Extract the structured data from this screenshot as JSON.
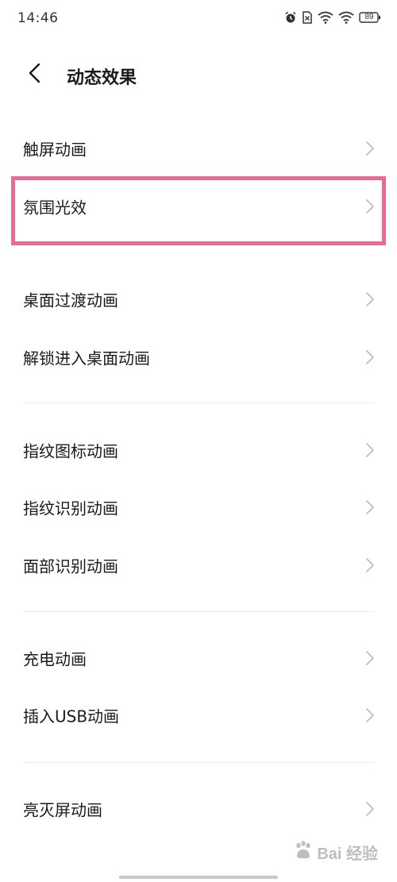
{
  "status_bar": {
    "time": "14:46",
    "battery": "89",
    "icons": [
      "alarm-icon",
      "sim-off-icon",
      "wifi-icon",
      "wifi-icon",
      "battery-icon"
    ]
  },
  "header": {
    "back_icon": "chevron-left-icon",
    "title": "动态效果"
  },
  "groups": [
    {
      "items": [
        {
          "label": "触屏动画"
        },
        {
          "label": "氛围光效"
        }
      ]
    },
    {
      "items": [
        {
          "label": "桌面过渡动画"
        },
        {
          "label": "解锁进入桌面动画"
        }
      ]
    },
    {
      "items": [
        {
          "label": "指纹图标动画"
        },
        {
          "label": "指纹识别动画"
        },
        {
          "label": "面部识别动画"
        }
      ]
    },
    {
      "items": [
        {
          "label": "充电动画"
        },
        {
          "label": "插入USB动画"
        }
      ]
    },
    {
      "items": [
        {
          "label": "亮灭屏动画"
        }
      ]
    }
  ],
  "highlight_color": "#ea6a97",
  "watermark": {
    "text": "Bai 经验",
    "icon": "baidu-paw-icon"
  }
}
